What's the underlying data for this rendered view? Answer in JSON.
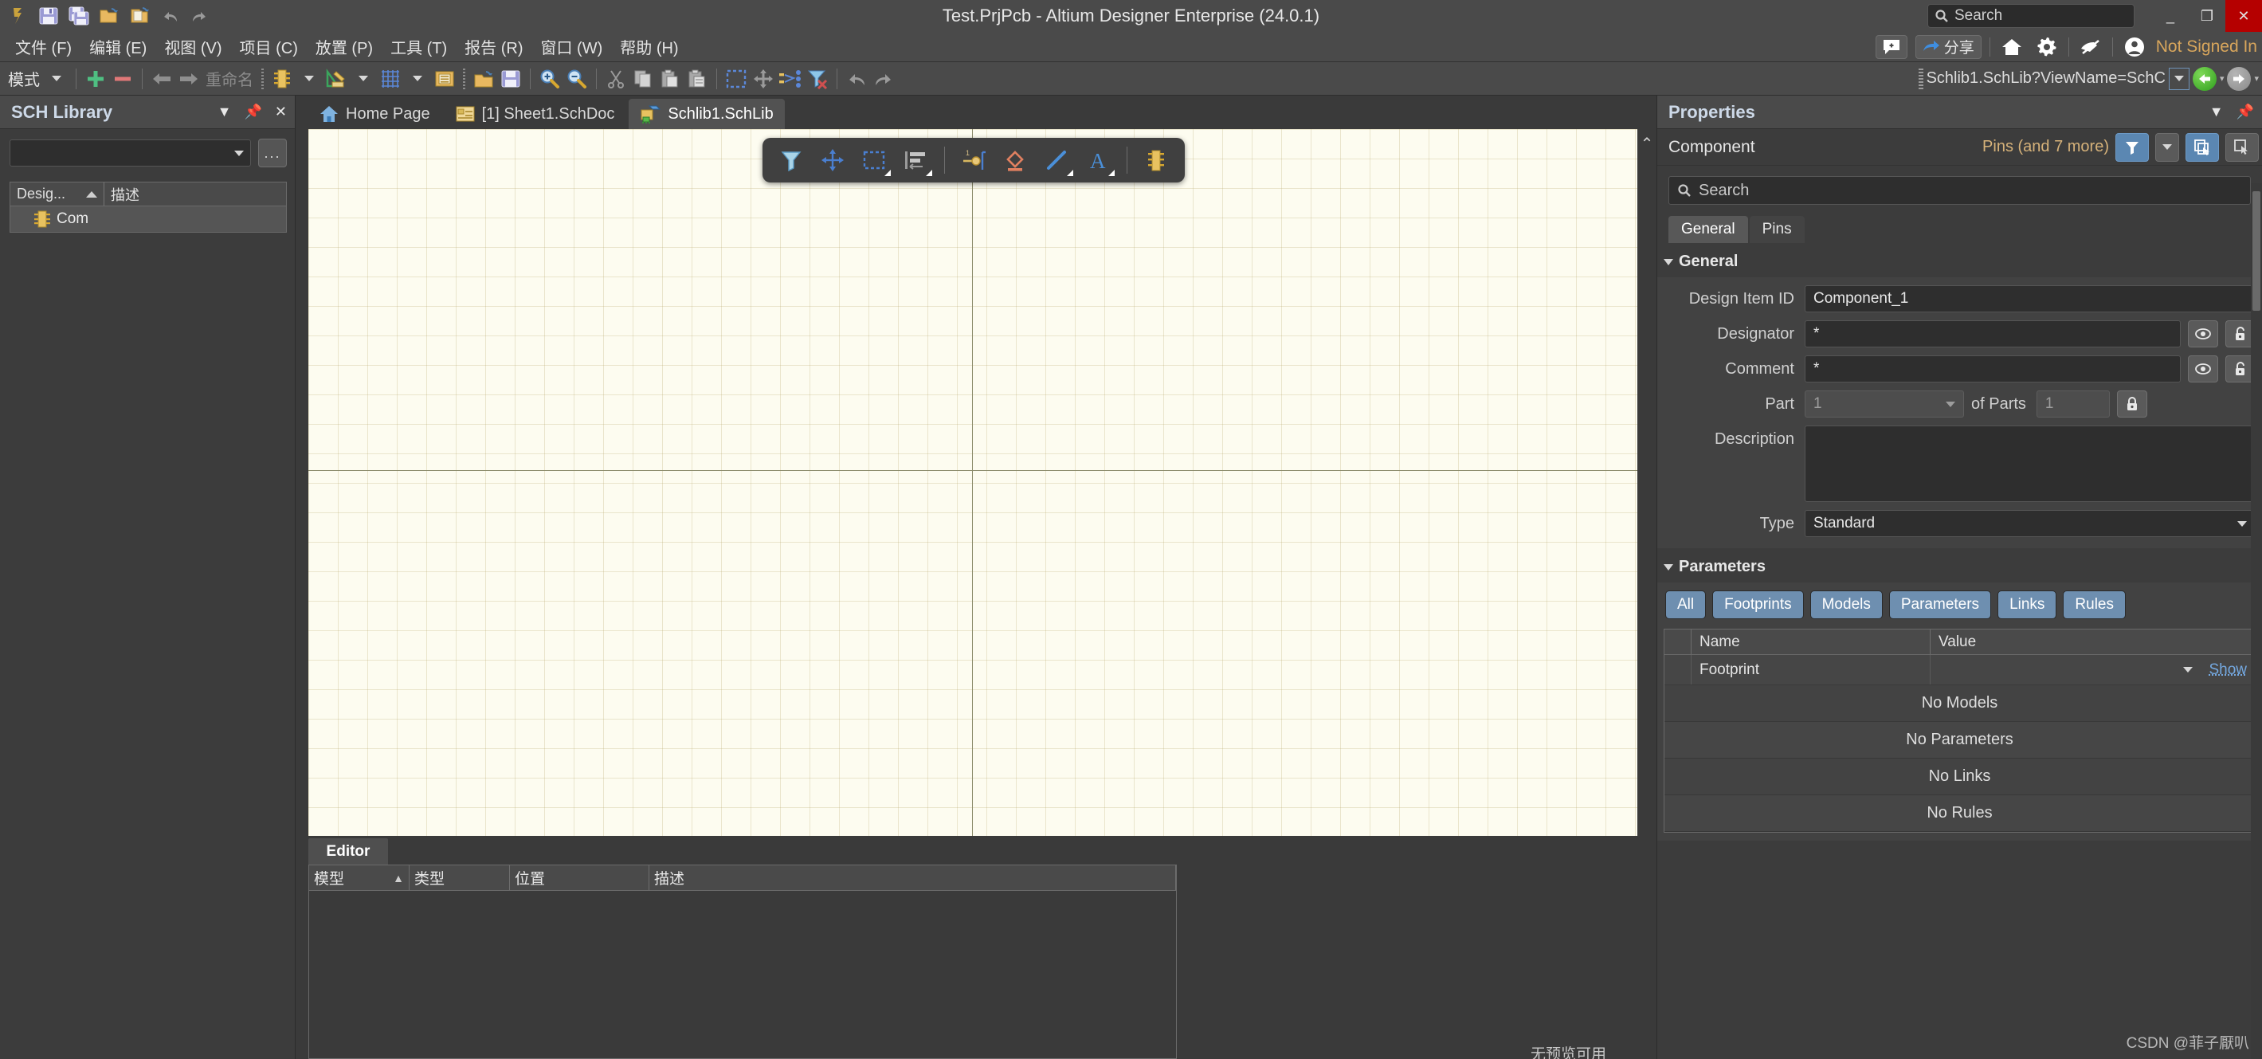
{
  "window": {
    "title": "Test.PrjPcb - Altium Designer Enterprise (24.0.1)",
    "minimize_label": "_",
    "restore_label": "❐",
    "close_label": "✕"
  },
  "quick_access": [
    {
      "name": "altium-logo-icon",
      "label": ""
    },
    {
      "name": "save-icon",
      "label": ""
    },
    {
      "name": "save-all-icon",
      "label": ""
    },
    {
      "name": "open-project-icon",
      "label": ""
    },
    {
      "name": "open-document-icon",
      "label": ""
    },
    {
      "name": "undo-icon",
      "label": ""
    },
    {
      "name": "redo-icon",
      "label": ""
    }
  ],
  "global_search": {
    "placeholder": "Search"
  },
  "menu": {
    "items": [
      {
        "label": "文件 (F)"
      },
      {
        "label": "编辑 (E)"
      },
      {
        "label": "视图 (V)"
      },
      {
        "label": "项目 (C)"
      },
      {
        "label": "放置 (P)"
      },
      {
        "label": "工具 (T)"
      },
      {
        "label": "报告 (R)"
      },
      {
        "label": "窗口 (W)"
      },
      {
        "label": "帮助 (H)"
      }
    ],
    "notification_label": "+",
    "share_label": "分享",
    "account_status": "Not Signed In"
  },
  "toolbar": {
    "mode_label": "模式",
    "add_label": "+",
    "remove_label": "−",
    "rename_label": "重命名",
    "url": "Schlib1.SchLib?ViewName=SchC"
  },
  "sch_library": {
    "title": "SCH Library",
    "library_select_value": "",
    "dots_label": "...",
    "columns": [
      "Desig...",
      "描述"
    ],
    "rows": [
      {
        "designator": "Com",
        "description": ""
      }
    ]
  },
  "doc_tabs": [
    {
      "label": "Home Page",
      "icon": "home-icon",
      "active": false
    },
    {
      "label": "[1] Sheet1.SchDoc",
      "icon": "schdoc-icon",
      "active": false
    },
    {
      "label": "Schlib1.SchLib",
      "icon": "schlib-icon",
      "active": true
    }
  ],
  "canvas_toolbar": [
    {
      "name": "filter-icon"
    },
    {
      "name": "move-icon"
    },
    {
      "name": "select-region-icon"
    },
    {
      "name": "align-icon"
    },
    {
      "name": "place-pin-icon"
    },
    {
      "name": "place-shape-icon"
    },
    {
      "name": "place-line-icon"
    },
    {
      "name": "place-text-icon"
    },
    {
      "name": "place-component-icon"
    }
  ],
  "editor_panel": {
    "tab_label": "Editor",
    "columns": [
      "模型",
      "类型",
      "位置",
      "描述"
    ],
    "rows": [],
    "preview_note": "无预览可用"
  },
  "properties": {
    "title": "Properties",
    "object_type": "Component",
    "object_count": "Pins (and 7 more)",
    "search_placeholder": "Search",
    "tabs": [
      {
        "label": "General",
        "active": true
      },
      {
        "label": "Pins",
        "active": false
      }
    ],
    "general": {
      "section_label": "General",
      "design_item_id_label": "Design Item ID",
      "design_item_id_value": "Component_1",
      "designator_label": "Designator",
      "designator_value": "*",
      "comment_label": "Comment",
      "comment_value": "*",
      "part_label": "Part",
      "part_value": "1",
      "of_parts_label": "of Parts",
      "of_parts_value": "1",
      "description_label": "Description",
      "description_value": "",
      "type_label": "Type",
      "type_value": "Standard"
    },
    "parameters": {
      "section_label": "Parameters",
      "filter_buttons": [
        "All",
        "Footprints",
        "Models",
        "Parameters",
        "Links",
        "Rules"
      ],
      "columns": [
        "Name",
        "Value"
      ],
      "rows": [
        {
          "name": "Footprint",
          "value": "",
          "action": "Show"
        }
      ],
      "empty_messages": [
        "No Models",
        "No Parameters",
        "No Links",
        "No Rules"
      ]
    }
  },
  "watermark": "CSDN @菲子厭叭",
  "colors": {
    "accent_blue": "#5b87b2",
    "canvas_bg": "#fdfcf0",
    "chrome_bg": "#3a3a3a",
    "titlebar_bg": "#4a4a4a",
    "close_red": "#b50000",
    "signed_out_orange": "#d8a65c"
  }
}
